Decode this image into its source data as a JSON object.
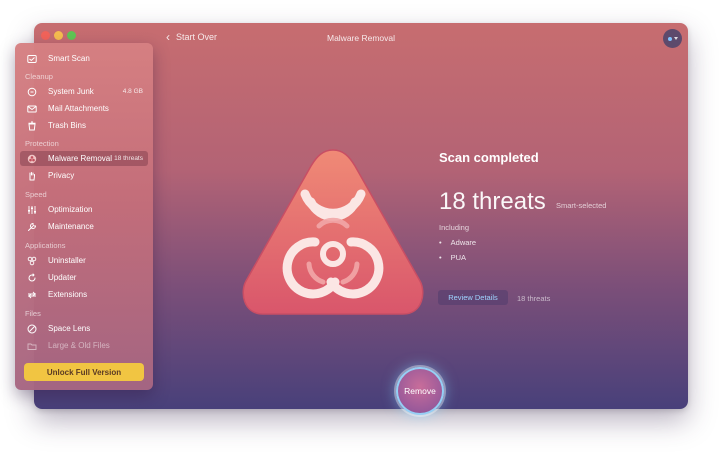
{
  "window": {
    "title": "Malware Removal",
    "back_label": "Start Over"
  },
  "sidebar": {
    "smart_scan": "Smart Scan",
    "sections": {
      "cleanup": "Cleanup",
      "protection": "Protection",
      "speed": "Speed",
      "applications": "Applications",
      "files": "Files"
    },
    "items": {
      "system_junk": {
        "label": "System Junk",
        "meta": "4.8 GB"
      },
      "mail_attachments": {
        "label": "Mail Attachments"
      },
      "trash_bins": {
        "label": "Trash Bins"
      },
      "malware_removal": {
        "label": "Malware Removal",
        "meta": "18 threats"
      },
      "privacy": {
        "label": "Privacy"
      },
      "optimization": {
        "label": "Optimization"
      },
      "maintenance": {
        "label": "Maintenance"
      },
      "uninstaller": {
        "label": "Uninstaller"
      },
      "updater": {
        "label": "Updater"
      },
      "extensions": {
        "label": "Extensions"
      },
      "space_lens": {
        "label": "Space Lens"
      },
      "large_old_files": {
        "label": "Large & Old Files"
      }
    },
    "unlock_label": "Unlock Full Version"
  },
  "result": {
    "heading": "Scan completed",
    "threat_count": "18 threats",
    "smart_selected": "Smart-selected",
    "including": "Including",
    "threats": [
      "Adware",
      "PUA"
    ],
    "review_label": "Review Details",
    "review_count": "18 threats"
  },
  "actions": {
    "remove_label": "Remove"
  },
  "colors": {
    "accent_yellow": "#f1c542",
    "link_blue": "#9fd4ff",
    "hazard_fill": "#e5656e"
  }
}
